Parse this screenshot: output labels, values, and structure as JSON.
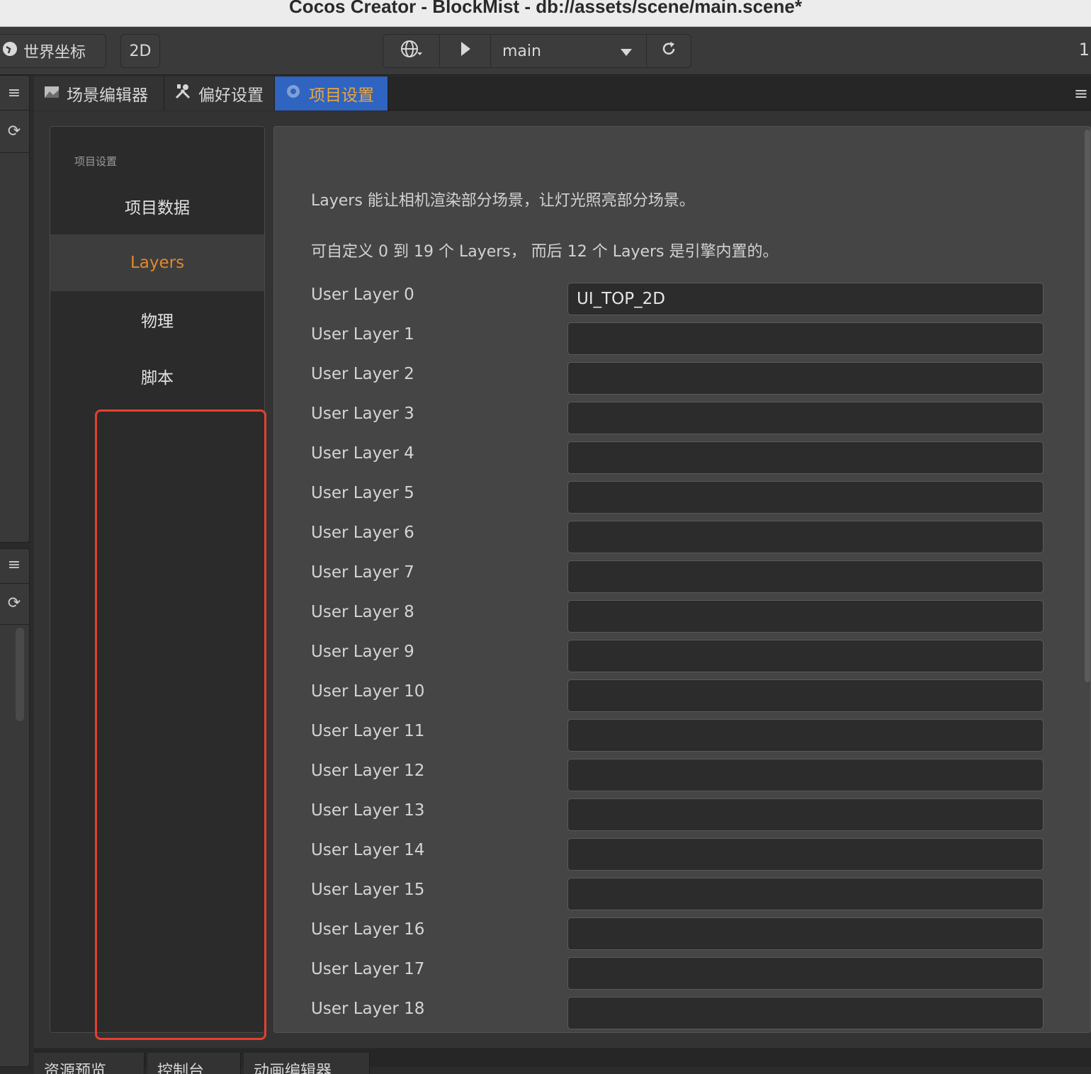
{
  "window": {
    "title": "Cocos Creator - BlockMist - db://assets/scene/main.scene*"
  },
  "toolbar": {
    "world_coords_label": "世界坐标",
    "mode_2d_label": "2D",
    "scene_name": "main",
    "right_number": "1"
  },
  "tabs": [
    {
      "label": "场景编辑器",
      "icon": "scene-icon"
    },
    {
      "label": "偏好设置",
      "icon": "tools-icon"
    },
    {
      "label": "项目设置",
      "icon": "gear-icon",
      "active": true
    }
  ],
  "nav": {
    "heading": "项目设置",
    "items": [
      {
        "label": "项目数据"
      },
      {
        "label": "Layers",
        "active": true
      },
      {
        "label": "物理"
      },
      {
        "label": "脚本"
      }
    ]
  },
  "main": {
    "description_1": "Layers 能让相机渲染部分场景，让灯光照亮部分场景。",
    "description_2": "可自定义 0 到 19 个 Layers， 而后 12 个 Layers 是引擎内置的。",
    "layers": [
      {
        "label": "User Layer 0",
        "value": "UI_TOP_2D"
      },
      {
        "label": "User Layer 1",
        "value": ""
      },
      {
        "label": "User Layer 2",
        "value": ""
      },
      {
        "label": "User Layer 3",
        "value": ""
      },
      {
        "label": "User Layer 4",
        "value": ""
      },
      {
        "label": "User Layer 5",
        "value": ""
      },
      {
        "label": "User Layer 6",
        "value": ""
      },
      {
        "label": "User Layer 7",
        "value": ""
      },
      {
        "label": "User Layer 8",
        "value": ""
      },
      {
        "label": "User Layer 9",
        "value": ""
      },
      {
        "label": "User Layer 10",
        "value": ""
      },
      {
        "label": "User Layer 11",
        "value": ""
      },
      {
        "label": "User Layer 12",
        "value": ""
      },
      {
        "label": "User Layer 13",
        "value": ""
      },
      {
        "label": "User Layer 14",
        "value": ""
      },
      {
        "label": "User Layer 15",
        "value": ""
      },
      {
        "label": "User Layer 16",
        "value": ""
      },
      {
        "label": "User Layer 17",
        "value": ""
      },
      {
        "label": "User Layer 18",
        "value": ""
      }
    ]
  },
  "bottom_tabs": [
    {
      "label": "资源预览"
    },
    {
      "label": "控制台"
    },
    {
      "label": "动画编辑器"
    }
  ],
  "colors": {
    "active_tab": "#2f64c0",
    "active_text": "#e0892b",
    "highlight_box": "#e5402f"
  }
}
